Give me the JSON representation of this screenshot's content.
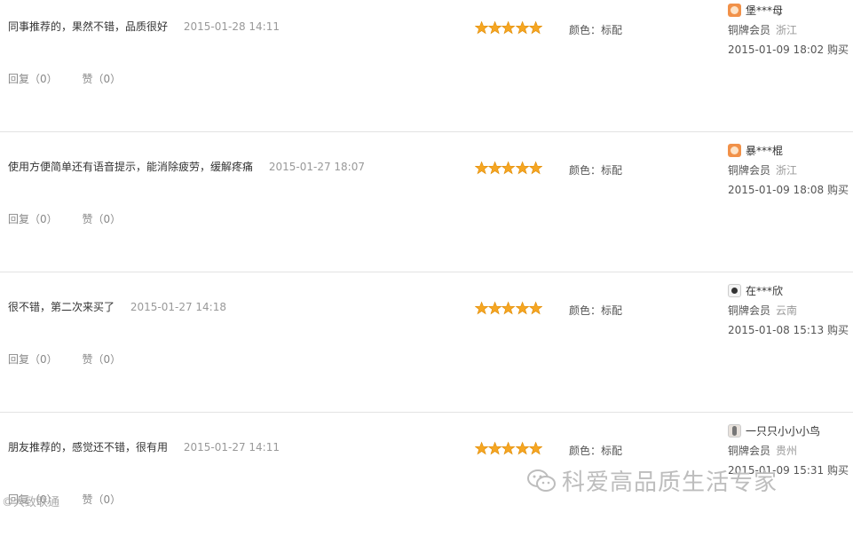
{
  "reviews": [
    {
      "text": "同事推荐的，果然不错，品质很好",
      "date": "2015-01-28 14:11",
      "reply": "回复（0）",
      "like": "赞（0）",
      "rating": 5,
      "attr": "颜色：标配",
      "user": {
        "name": "堡***母",
        "avatar": "orange-avatar-icon",
        "level": "铜牌会员",
        "region": "浙江",
        "purchase": "2015-01-09 18:02 购买"
      }
    },
    {
      "text": "使用方便简单还有语音提示，能消除疲劳，缓解疼痛",
      "date": "2015-01-27 18:07",
      "reply": "回复（0）",
      "like": "赞（0）",
      "rating": 5,
      "attr": "颜色：标配",
      "user": {
        "name": "暴***棍",
        "avatar": "orange-avatar-icon",
        "level": "铜牌会员",
        "region": "浙江",
        "purchase": "2015-01-09 18:08 购买"
      }
    },
    {
      "text": "很不错，第二次来买了",
      "date": "2015-01-27 14:18",
      "reply": "回复（0）",
      "like": "赞（0）",
      "rating": 5,
      "attr": "颜色：标配",
      "user": {
        "name": "在***欣",
        "avatar": "panda-avatar-icon",
        "level": "铜牌会员",
        "region": "云南",
        "purchase": "2015-01-08 15:13 购买"
      }
    },
    {
      "text": "朋友推荐的，感觉还不错，很有用",
      "date": "2015-01-27 14:11",
      "reply": "回复（0）",
      "like": "赞（0）",
      "rating": 5,
      "attr": "颜色：标配",
      "user": {
        "name": "一只只小小小鸟",
        "avatar": "girl-avatar-icon",
        "level": "铜牌会员",
        "region": "贵州",
        "purchase": "2015-01-09 15:31 购买"
      }
    }
  ],
  "watermark": {
    "text": "科爱高品质生活专家",
    "icon": "wechat-icon"
  },
  "colors": {
    "star": "#f5a623",
    "star_stroke": "#e08a00",
    "divider": "#e3e3e3",
    "muted": "#999999"
  }
}
